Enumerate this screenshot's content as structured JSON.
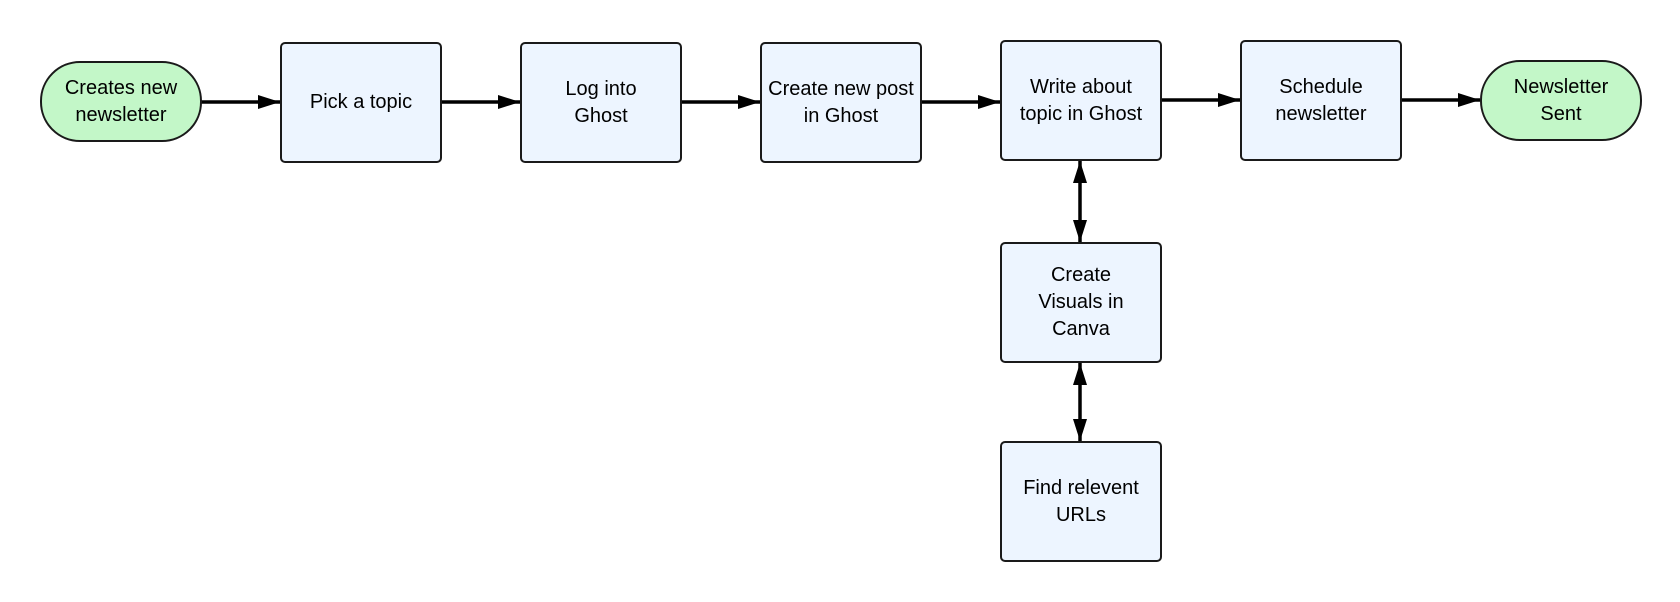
{
  "nodes": {
    "start": "Creates new newsletter",
    "pick_topic": "Pick a topic",
    "log_into": "Log into Ghost",
    "create_post": "Create new post in Ghost",
    "write": "Write about topic in Ghost",
    "schedule": "Schedule newsletter",
    "end": "Newsletter Sent",
    "visuals": "Create Visuals in Canva",
    "urls": "Find relevent URLs"
  },
  "colors": {
    "terminal_fill": "#c3f7c8",
    "process_fill": "#edf5ff",
    "stroke": "#1a1a1a"
  }
}
